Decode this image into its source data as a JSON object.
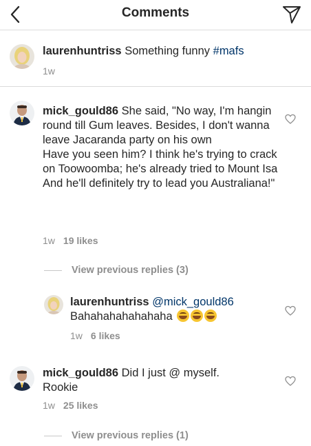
{
  "header": {
    "title": "Comments"
  },
  "caption": {
    "username": "laurenhuntriss",
    "text": "Something funny",
    "hashtag": "#mafs",
    "time": "1w"
  },
  "comments": [
    {
      "username": "mick_gould86",
      "text": "She said, \"No way, I'm hangin round till Gum leaves. Besides, I don't wanna leave Jacaranda party on his own",
      "text2": "Have you seen him? I think he's trying to crack on Toowoomba; he's already tried to Mount Isa",
      "text3": "And he'll definitely try to lead you Australiana!\"",
      "time": "1w",
      "likes": "19 likes",
      "view_replies": "View previous replies (3)",
      "reply": {
        "username": "laurenhuntriss",
        "mention": "@mick_gould86",
        "text": "Bahahahahahahaha",
        "emoji": "rolling-on-floor-laughing",
        "time": "1w",
        "likes": "6 likes"
      }
    },
    {
      "username": "mick_gould86",
      "text": "Did I just @ myself.",
      "text2": "Rookie",
      "time": "1w",
      "likes": "25 likes",
      "view_replies": "View previous replies (1)"
    }
  ],
  "icons": {
    "back": "chevron-left-icon",
    "send": "paper-plane-icon",
    "like": "heart-icon"
  },
  "colors": {
    "text": "#262626",
    "muted": "#8e8e8e",
    "hashtag": "#003569",
    "divider": "#dbdbdb"
  }
}
